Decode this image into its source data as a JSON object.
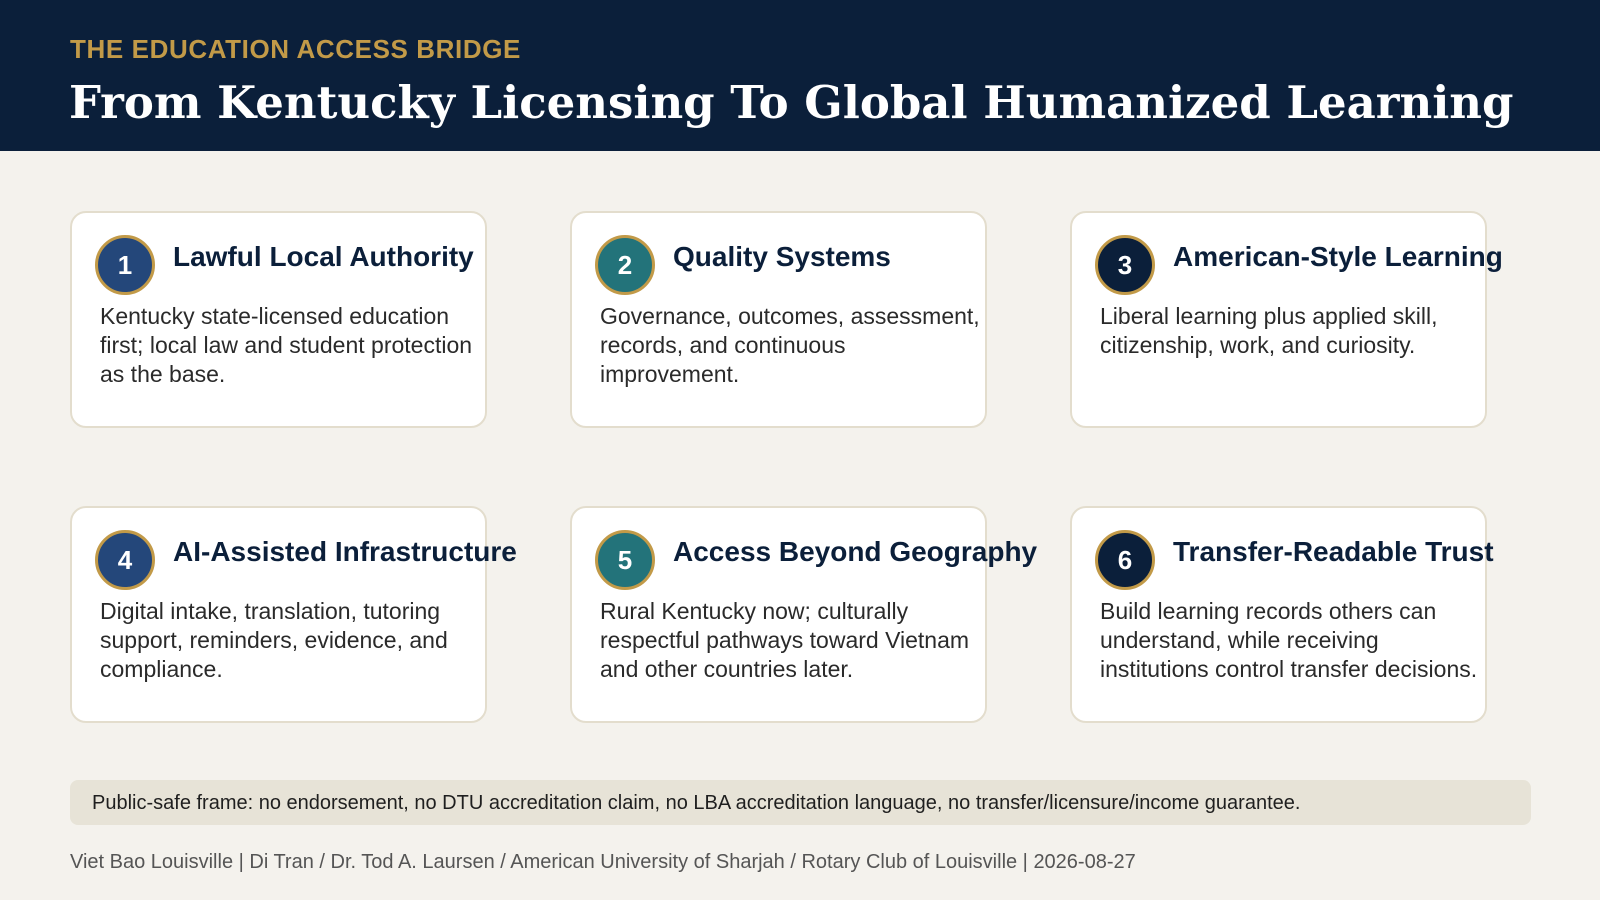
{
  "header": {
    "kicker": "THE EDUCATION ACCESS BRIDGE",
    "title": "From Kentucky Licensing To Global Humanized Learning"
  },
  "cards": [
    {
      "number": "1",
      "title": "Lawful Local Authority",
      "body": "Kentucky state-licensed education first; local law and student protection as the base.",
      "badge_color": "#24477a"
    },
    {
      "number": "2",
      "title": "Quality Systems",
      "body": "Governance, outcomes, assessment, records, and continuous improvement.",
      "badge_color": "#23737a"
    },
    {
      "number": "3",
      "title": "American-Style Learning",
      "body": "Liberal learning plus applied skill, citizenship, work, and curiosity.",
      "badge_color": "#0b1f3a"
    },
    {
      "number": "4",
      "title": "AI-Assisted Infrastructure",
      "body": "Digital intake, translation, tutoring support, reminders, evidence, and compliance.",
      "badge_color": "#24477a"
    },
    {
      "number": "5",
      "title": "Access Beyond Geography",
      "body": "Rural Kentucky now; culturally respectful pathways toward Vietnam and other countries later.",
      "badge_color": "#23737a"
    },
    {
      "number": "6",
      "title": "Transfer-Readable Trust",
      "body": "Build learning records others can understand, while receiving institutions control transfer decisions.",
      "badge_color": "#0b1f3a"
    }
  ],
  "note": "Public-safe frame: no endorsement, no DTU accreditation claim, no LBA accreditation language, no transfer/licensure/income guarantee.",
  "footer": "Viet Bao Louisville | Di Tran / Dr. Tod A. Laursen / American University of Sharjah / Rotary Club of Louisville | 2026-08-27",
  "colors": {
    "header_bg": "#0b1f3a",
    "accent_gold": "#c29a48",
    "page_bg": "#f4f2ed"
  }
}
